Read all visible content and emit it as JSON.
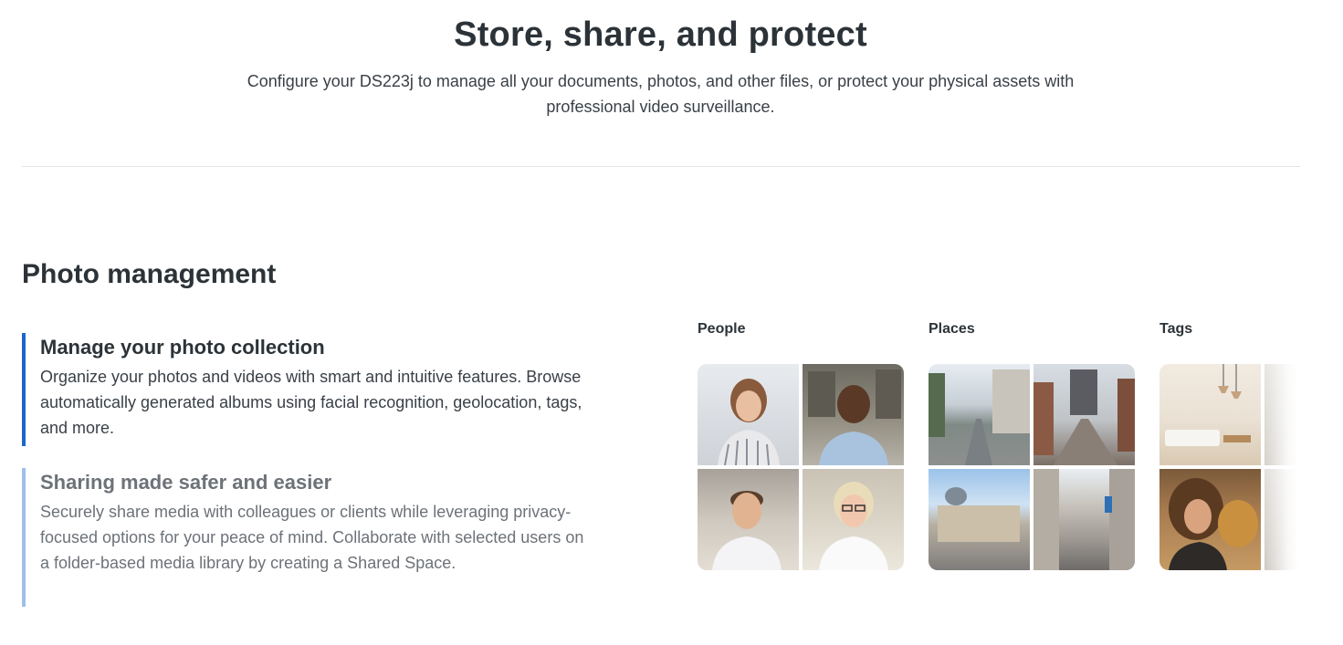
{
  "hero": {
    "title": "Store, share, and protect",
    "subtitle": "Configure your DS223j to manage all your documents, photos, and other files, or protect your physical assets with professional video surveillance."
  },
  "section": {
    "title": "Photo management"
  },
  "features": [
    {
      "title": "Manage your photo collection",
      "description": "Organize your photos and videos with smart and intuitive features. Browse automatically generated albums using facial recognition, geolocation, tags, and more."
    },
    {
      "title": "Sharing made safer and easier",
      "description": "Securely share media with colleagues or clients while leveraging privacy-focused options for your peace of mind. Collaborate with selected users on a folder-based media library by creating a Shared Space."
    }
  ],
  "gallery": {
    "people_label": "People",
    "places_label": "Places",
    "tags_label": "Tags"
  },
  "colors": {
    "accent_active": "#1a66c9",
    "accent_inactive": "#9ebfe8",
    "text_primary": "#2c3338",
    "text_muted": "#6d7278"
  }
}
